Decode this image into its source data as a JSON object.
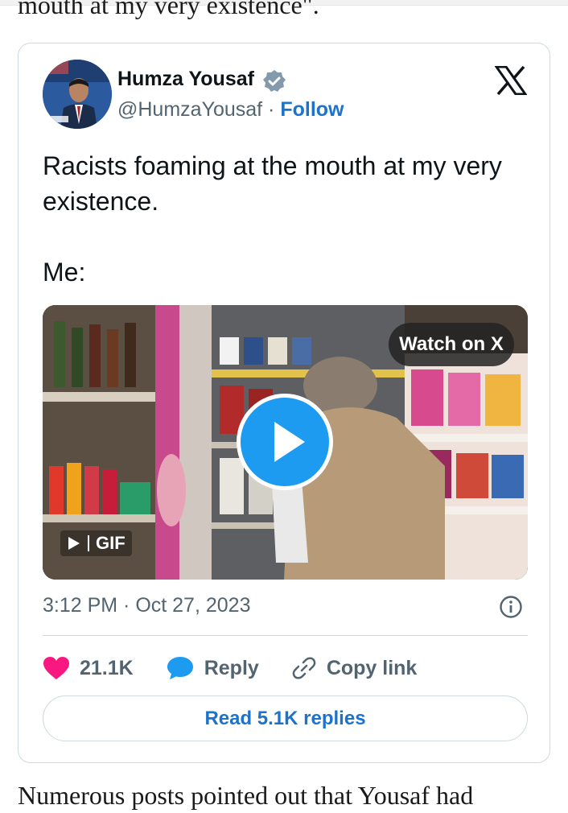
{
  "article": {
    "top_text": "mouth at my very existence\".",
    "bottom_text": "Numerous posts pointed out that Yousaf had"
  },
  "tweet": {
    "author_name": "Humza Yousaf",
    "handle": "@HumzaYousaf",
    "separator": " · ",
    "follow_label": "Follow",
    "text_line1": "Racists foaming at the mouth at my very existence.",
    "text_line2": "Me:",
    "media": {
      "watch_label": "Watch on X",
      "gif_label": "GIF"
    },
    "timestamp": "3:12 PM · Oct 27, 2023",
    "actions": {
      "likes": "21.1K",
      "reply_label": "Reply",
      "copy_label": "Copy link"
    },
    "read_replies_label": "Read 5.1K replies"
  },
  "colors": {
    "link_blue": "#1d73c9",
    "play_blue": "#1d9bf0",
    "heart_pink": "#f91880",
    "reply_blue": "#1d9bf0",
    "muted": "#536471"
  },
  "icons": [
    "verified-badge-icon",
    "x-logo-icon",
    "play-icon",
    "info-icon",
    "heart-icon",
    "reply-bubble-icon",
    "link-icon"
  ]
}
